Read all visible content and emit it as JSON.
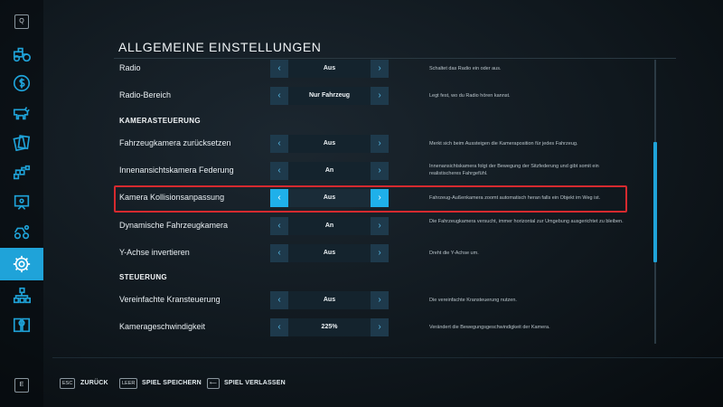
{
  "sidebar": {
    "top_key": "Q",
    "bottom_key": "E",
    "items": [
      {
        "icon": "tractor-icon"
      },
      {
        "icon": "dollar-icon"
      },
      {
        "icon": "cow-icon"
      },
      {
        "icon": "contracts-icon"
      },
      {
        "icon": "production-chain-icon"
      },
      {
        "icon": "statistics-icon"
      },
      {
        "icon": "garage-icon"
      },
      {
        "icon": "gear-icon",
        "active": true
      },
      {
        "icon": "hierarchy-icon"
      },
      {
        "icon": "help-book-icon"
      }
    ],
    "accent": "#1fa3d9"
  },
  "header": {
    "title": "ALLGEMEINE EINSTELLUNGEN"
  },
  "settings": [
    {
      "label": "Radio",
      "value": "Aus",
      "desc": "Schaltet das Radio ein oder aus."
    },
    {
      "label": "Radio-Bereich",
      "value": "Nur Fahrzeug",
      "desc": "Legt fest, wo du Radio hören kannst."
    },
    {
      "label": "Fahrzeugkamera zurücksetzen",
      "value": "Aus",
      "desc": "Merkt sich beim Aussteigen die Kameraposition für jedes Fahrzeug."
    },
    {
      "label": "Innenansichtskamera Federung",
      "value": "An",
      "desc": "Innenansichtskamera folgt der Bewegung der Sitzfederung und gibt somit ein realistischeres Fahrgefühl."
    },
    {
      "label": "Kamera Kollisionsanpassung",
      "value": "Aus",
      "desc": "Fahrzeug-Außenkamera zoomt automatisch heran falls ein Objekt im Weg ist."
    },
    {
      "label": "Dynamische Fahrzeugkamera",
      "value": "An",
      "desc": "Die Fahrzeugkamera versucht, immer horizontal zur Umgebung ausgerichtet zu bleiben."
    },
    {
      "label": "Y-Achse invertieren",
      "value": "Aus",
      "desc": "Dreht die Y-Achse um."
    },
    {
      "label": "Vereinfachte Kransteuerung",
      "value": "Aus",
      "desc": "Die vereinfachte Kransteuerung nutzen."
    },
    {
      "label": "Kamerageschwindigkeit",
      "value": "225%",
      "desc": "Verändert die Bewegungsgeschwindigkeit der Kamera."
    }
  ],
  "sections": {
    "camera": "KAMERASTEUERUNG",
    "control": "STEUERUNG"
  },
  "arrows": {
    "left": "‹",
    "right": "›"
  },
  "footer": [
    {
      "key": "ESC",
      "label": "ZURÜCK"
    },
    {
      "key": "LEER",
      "label": "SPIEL SPEICHERN"
    },
    {
      "key": "⟵",
      "label": "SPIEL VERLASSEN"
    }
  ],
  "colors": {
    "highlight_border": "#d62a2f",
    "accent": "#1fa3d9"
  }
}
